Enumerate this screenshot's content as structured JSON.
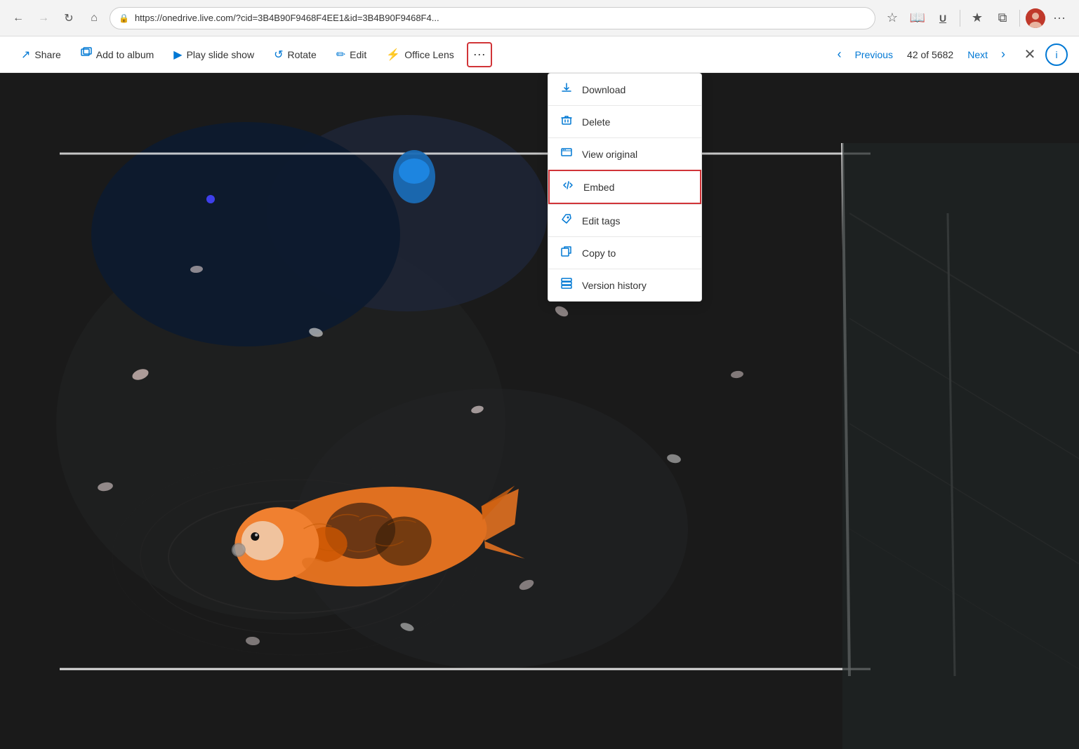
{
  "browser": {
    "url": "https://onedrive.live.com/?cid=3B4B90F9468F4EE1&id=3B4B90F9468F4...",
    "back_disabled": false,
    "forward_disabled": true
  },
  "toolbar": {
    "share_label": "Share",
    "add_to_album_label": "Add to album",
    "play_slide_show_label": "Play slide show",
    "rotate_label": "Rotate",
    "edit_label": "Edit",
    "office_lens_label": "Office Lens",
    "more_label": "···",
    "previous_label": "Previous",
    "next_label": "Next",
    "page_counter": "42 of 5682"
  },
  "menu": {
    "download_label": "Download",
    "delete_label": "Delete",
    "view_original_label": "View original",
    "embed_label": "Embed",
    "edit_tags_label": "Edit tags",
    "copy_to_label": "Copy to",
    "version_history_label": "Version history"
  },
  "icons": {
    "share": "↗",
    "album": "🖼",
    "play": "▶",
    "rotate": "↺",
    "edit": "✏",
    "lens": "⚡",
    "more": "···",
    "prev": "‹",
    "next": "›",
    "close": "✕",
    "info": "ⓘ",
    "download_icon": "⬇",
    "delete_icon": "🗑",
    "view_original_icon": "🖥",
    "embed_icon": "</>",
    "tags_icon": "🏷",
    "copy_icon": "📋",
    "history_icon": "🕐",
    "lock": "🔒",
    "back": "←",
    "forward": "→",
    "refresh": "↻",
    "home": "⌂"
  }
}
